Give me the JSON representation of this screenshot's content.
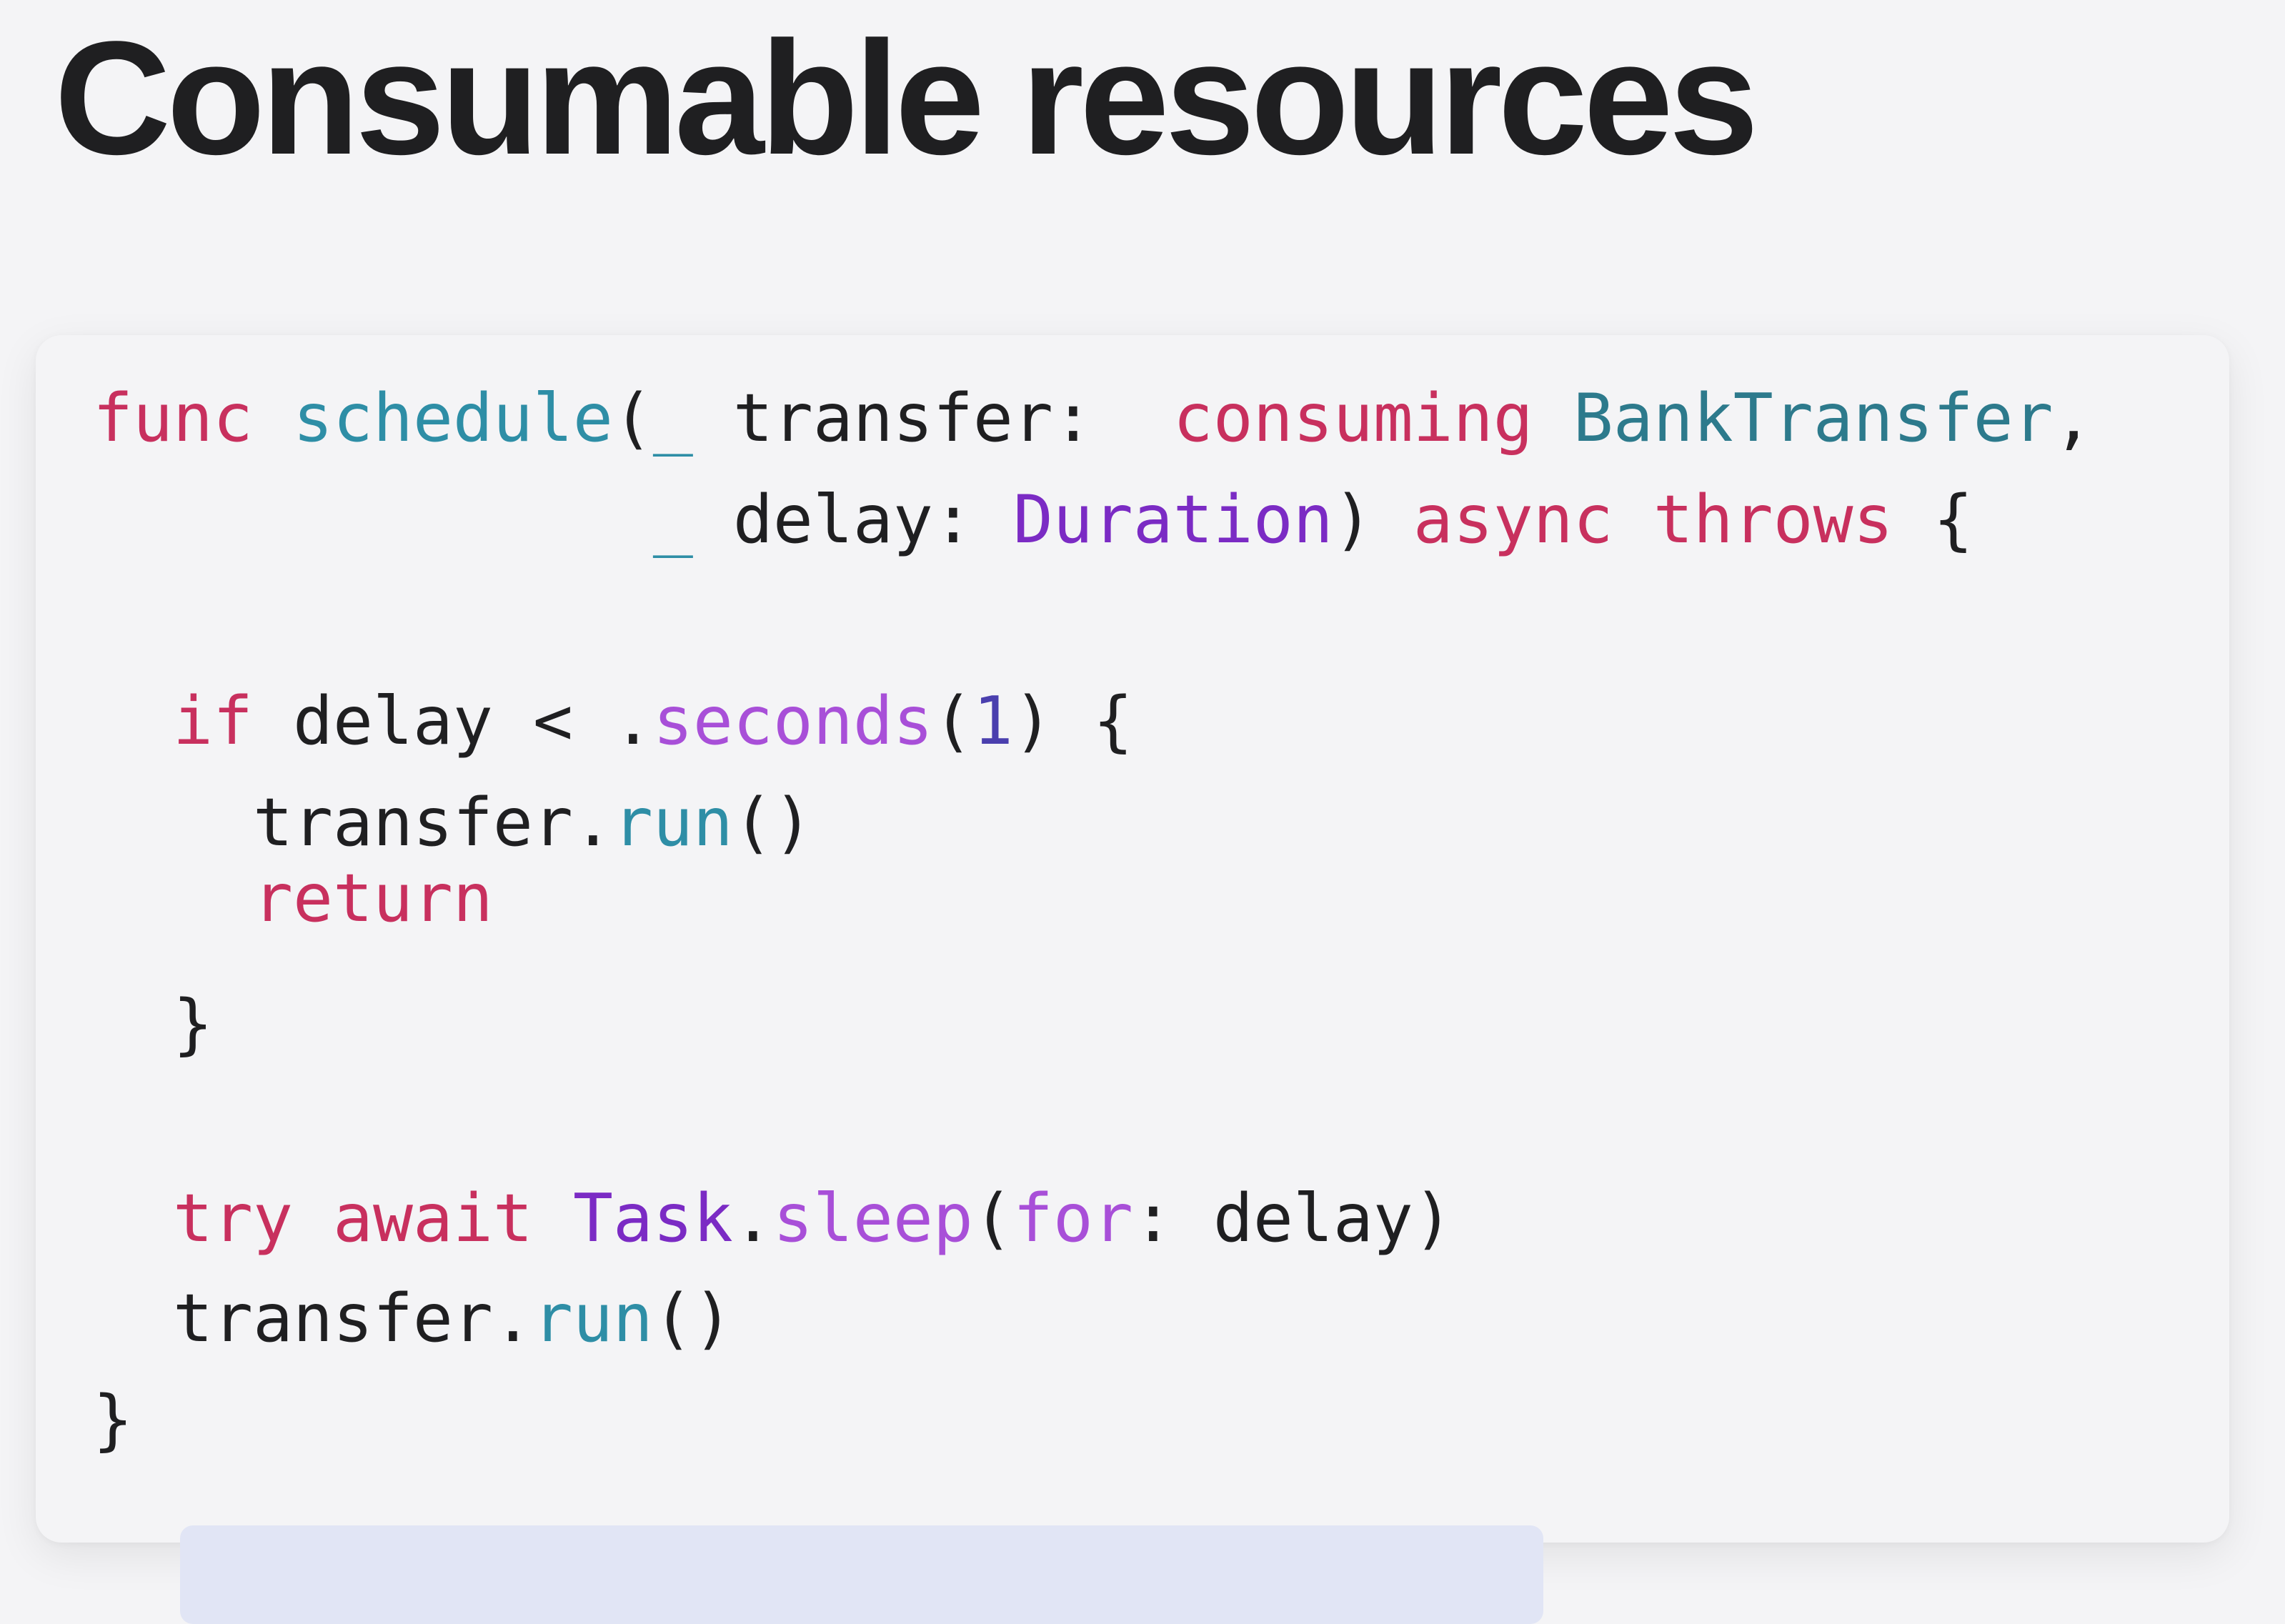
{
  "slide": {
    "title": "Consumable resources"
  },
  "code": {
    "line1": {
      "kw_func": "func",
      "sp1": " ",
      "fn_schedule": "schedule",
      "paren_open": "(",
      "underscore": "_",
      "param_transfer": " transfer: ",
      "kw_consuming": " consuming",
      "sp2": " ",
      "type_banktransfer": "BankTransfer",
      "comma": ","
    },
    "line2": {
      "indent": "              ",
      "underscore": "_",
      "param_delay": " delay: ",
      "type_duration": "Duration",
      "paren_close": ") ",
      "kw_async": "async",
      "sp": " ",
      "kw_throws": "throws",
      "brace": " {"
    },
    "line3": {
      "indent": "  ",
      "kw_if": "if",
      "cond": " delay < .",
      "mth_seconds": "seconds",
      "paren_open": "(",
      "num_one": "1",
      "rest": ") {"
    },
    "line4": {
      "indent": "    ",
      "obj": "transfer.",
      "fn_run": "run",
      "call": "()"
    },
    "line5": {
      "indent": "    ",
      "kw_return": "return"
    },
    "line6": {
      "text": "  }"
    },
    "line7": {
      "indent": "  ",
      "kw_try": "try",
      "sp1": " ",
      "kw_await": "await",
      "sp2": " ",
      "type_task": "Task",
      "dot": ".",
      "mth_sleep": "sleep",
      "paren_open": "(",
      "kw_for": "for",
      "rest": ": delay)"
    },
    "line8": {
      "indent": "  ",
      "obj": "transfer.",
      "fn_run": "run",
      "call": "()"
    },
    "line9": {
      "text": "}"
    }
  },
  "colors": {
    "background": "#f4f4f6",
    "keyword": "#c8305e",
    "function": "#2e8ea6",
    "type": "#2d7a8c",
    "type_duration": "#7b2bc4",
    "method": "#a84fd8",
    "number": "#4a3fae",
    "highlight": "#e1e5f5"
  }
}
